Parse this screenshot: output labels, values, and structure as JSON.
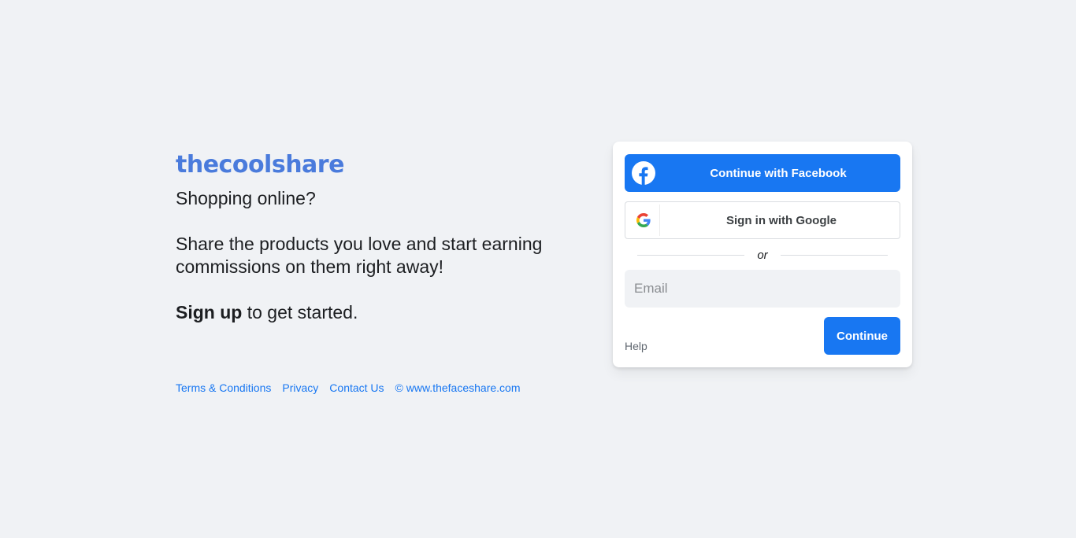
{
  "brand": {
    "logo_text": "thecoolshare",
    "logo_color": "#4a7bdc"
  },
  "hero": {
    "tagline": "Shopping online?",
    "pitch": "Share the products you love and start earning commissions on them right away!",
    "signup_bold": "Sign up",
    "signup_rest": " to get started."
  },
  "footer": {
    "links": [
      "Terms & Conditions",
      "Privacy",
      "Contact Us",
      "© www.thefaceshare.com"
    ]
  },
  "login": {
    "facebook_label": "Continue with Facebook",
    "google_label": "Sign in with Google",
    "divider_text": "or",
    "email_placeholder": "Email",
    "help_label": "Help",
    "continue_label": "Continue"
  },
  "colors": {
    "accent": "#1877f2",
    "background": "#f0f2f5"
  },
  "icons": {
    "facebook": "facebook-icon",
    "google": "google-icon"
  }
}
